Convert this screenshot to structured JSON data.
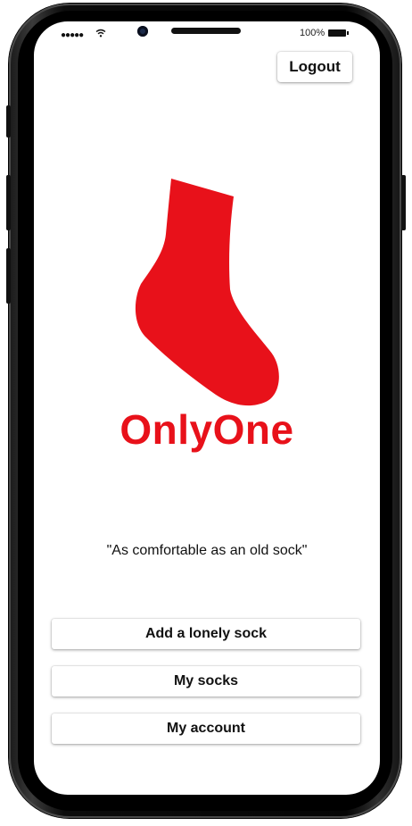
{
  "status_bar": {
    "signal": "●●●●●",
    "battery_percent": "100%"
  },
  "header": {
    "logout_label": "Logout"
  },
  "logo": {
    "icon": "sock-icon",
    "brand_name": "OnlyOne",
    "color": "#e8111a"
  },
  "tagline": "\"As comfortable as an old sock\"",
  "actions": [
    {
      "label": "Add a lonely sock"
    },
    {
      "label": "My socks"
    },
    {
      "label": "My account"
    }
  ]
}
